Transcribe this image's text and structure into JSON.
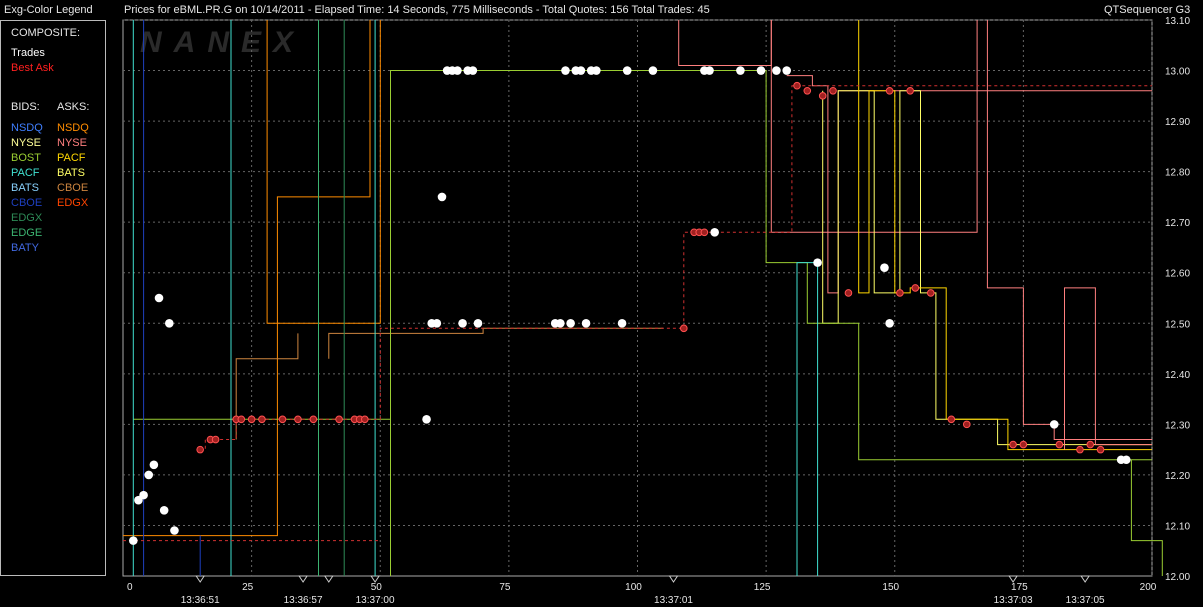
{
  "titlebar": {
    "legend_title": "Exg-Color Legend",
    "chart_title": "Prices for  eBML.PR.G  on  10/14/2011  -  Elapsed Time: 14 Seconds, 775 Milliseconds  -  Total Quotes: 156  Total Trades: 45",
    "app_name": "QTSequencer G3"
  },
  "legend": {
    "composite_label": "COMPOSITE:",
    "trades_label": "Trades",
    "best_ask_label": "Best Ask",
    "bids_header": "BIDS:",
    "asks_header": "ASKS:",
    "bids": [
      {
        "label": "NSDQ",
        "color": "#3f7fff"
      },
      {
        "label": "NYSE",
        "color": "#ffff99"
      },
      {
        "label": "BOST",
        "color": "#9acd32"
      },
      {
        "label": "PACF",
        "color": "#40e0d0"
      },
      {
        "label": "BATS",
        "color": "#87cefa"
      },
      {
        "label": "CBOE",
        "color": "#1e40c0"
      },
      {
        "label": "EDGX",
        "color": "#2e8b57"
      },
      {
        "label": "EDGE",
        "color": "#3cb371"
      },
      {
        "label": "BATY",
        "color": "#4169e1"
      }
    ],
    "asks": [
      {
        "label": "NSDQ",
        "color": "#ff8c00"
      },
      {
        "label": "NYSE",
        "color": "#ff7f7f"
      },
      {
        "label": "PACF",
        "color": "#ffd700"
      },
      {
        "label": "BATS",
        "color": "#ffff66"
      },
      {
        "label": "CBOE",
        "color": "#cd853f"
      },
      {
        "label": "EDGX",
        "color": "#ff4500"
      }
    ],
    "trades_color": "#ffffff",
    "best_ask_color": "#ff2020"
  },
  "watermark": "NANEX",
  "chart_data": {
    "type": "scatter",
    "x_ticks": [
      0,
      25,
      50,
      75,
      100,
      125,
      150,
      175,
      200
    ],
    "x_range": [
      0,
      200
    ],
    "y_ticks": [
      "12.00",
      "12.10",
      "12.20",
      "12.30",
      "12.40",
      "12.50",
      "12.60",
      "12.70",
      "12.80",
      "12.90",
      "13.00",
      "13.10"
    ],
    "y_range": [
      12.0,
      13.1
    ],
    "time_labels": [
      {
        "x": 15,
        "label": "13:36:51"
      },
      {
        "x": 35,
        "label": "13:36:57"
      },
      {
        "x": 49,
        "label": "13:37:00"
      },
      {
        "x": 107,
        "label": "13:37:01"
      },
      {
        "x": 173,
        "label": "13:37:03"
      },
      {
        "x": 187,
        "label": "13:37:05"
      }
    ],
    "time_markers": [
      15,
      35,
      40,
      49,
      107,
      173,
      187
    ],
    "grid": true,
    "trades": [
      {
        "x": 2,
        "y": 12.07
      },
      {
        "x": 3,
        "y": 12.15
      },
      {
        "x": 4,
        "y": 12.16
      },
      {
        "x": 5,
        "y": 12.2
      },
      {
        "x": 6,
        "y": 12.22
      },
      {
        "x": 7,
        "y": 12.55
      },
      {
        "x": 8,
        "y": 12.13
      },
      {
        "x": 9,
        "y": 12.5
      },
      {
        "x": 10,
        "y": 12.09
      },
      {
        "x": 59,
        "y": 12.31
      },
      {
        "x": 60,
        "y": 12.5
      },
      {
        "x": 61,
        "y": 12.5
      },
      {
        "x": 62,
        "y": 12.75
      },
      {
        "x": 63,
        "y": 13.0
      },
      {
        "x": 64,
        "y": 13.0
      },
      {
        "x": 65,
        "y": 13.0
      },
      {
        "x": 66,
        "y": 12.5
      },
      {
        "x": 67,
        "y": 13.0
      },
      {
        "x": 68,
        "y": 13.0
      },
      {
        "x": 69,
        "y": 12.5
      },
      {
        "x": 84,
        "y": 12.5
      },
      {
        "x": 85,
        "y": 12.5
      },
      {
        "x": 86,
        "y": 13.0
      },
      {
        "x": 87,
        "y": 12.5
      },
      {
        "x": 88,
        "y": 13.0
      },
      {
        "x": 89,
        "y": 13.0
      },
      {
        "x": 90,
        "y": 12.5
      },
      {
        "x": 91,
        "y": 13.0
      },
      {
        "x": 92,
        "y": 13.0
      },
      {
        "x": 97,
        "y": 12.5
      },
      {
        "x": 98,
        "y": 13.0
      },
      {
        "x": 103,
        "y": 13.0
      },
      {
        "x": 113,
        "y": 13.0
      },
      {
        "x": 114,
        "y": 13.0
      },
      {
        "x": 115,
        "y": 12.68
      },
      {
        "x": 120,
        "y": 13.0
      },
      {
        "x": 124,
        "y": 13.0
      },
      {
        "x": 127,
        "y": 13.0
      },
      {
        "x": 129,
        "y": 13.0
      },
      {
        "x": 135,
        "y": 12.62
      },
      {
        "x": 148,
        "y": 12.61
      },
      {
        "x": 149,
        "y": 12.5
      },
      {
        "x": 181,
        "y": 12.3
      },
      {
        "x": 194,
        "y": 12.23
      },
      {
        "x": 195,
        "y": 12.23
      }
    ],
    "best_ask_dots": [
      {
        "x": 15,
        "y": 12.25
      },
      {
        "x": 17,
        "y": 12.27
      },
      {
        "x": 18,
        "y": 12.27
      },
      {
        "x": 22,
        "y": 12.31
      },
      {
        "x": 23,
        "y": 12.31
      },
      {
        "x": 25,
        "y": 12.31
      },
      {
        "x": 27,
        "y": 12.31
      },
      {
        "x": 31,
        "y": 12.31
      },
      {
        "x": 34,
        "y": 12.31
      },
      {
        "x": 37,
        "y": 12.31
      },
      {
        "x": 42,
        "y": 12.31
      },
      {
        "x": 45,
        "y": 12.31
      },
      {
        "x": 46,
        "y": 12.31
      },
      {
        "x": 47,
        "y": 12.31
      },
      {
        "x": 109,
        "y": 12.49
      },
      {
        "x": 111,
        "y": 12.68
      },
      {
        "x": 112,
        "y": 12.68
      },
      {
        "x": 113,
        "y": 12.68
      },
      {
        "x": 131,
        "y": 12.97
      },
      {
        "x": 133,
        "y": 12.96
      },
      {
        "x": 136,
        "y": 12.95
      },
      {
        "x": 138,
        "y": 12.96
      },
      {
        "x": 141,
        "y": 12.56
      },
      {
        "x": 149,
        "y": 12.96
      },
      {
        "x": 151,
        "y": 12.56
      },
      {
        "x": 153,
        "y": 12.96
      },
      {
        "x": 154,
        "y": 12.57
      },
      {
        "x": 157,
        "y": 12.56
      },
      {
        "x": 161,
        "y": 12.31
      },
      {
        "x": 164,
        "y": 12.3
      },
      {
        "x": 173,
        "y": 12.26
      },
      {
        "x": 175,
        "y": 12.26
      },
      {
        "x": 182,
        "y": 12.26
      },
      {
        "x": 186,
        "y": 12.25
      },
      {
        "x": 188,
        "y": 12.26
      },
      {
        "x": 190,
        "y": 12.25
      }
    ],
    "best_ask_path": [
      [
        0,
        12.07
      ],
      [
        50,
        12.07
      ]
    ],
    "best_ask_path2": [
      [
        15,
        12.25
      ],
      [
        16,
        12.25
      ],
      [
        16,
        12.27
      ],
      [
        22,
        12.27
      ],
      [
        22,
        12.31
      ],
      [
        50,
        12.31
      ],
      [
        50,
        12.49
      ],
      [
        109,
        12.49
      ],
      [
        109,
        12.68
      ],
      [
        130,
        12.68
      ],
      [
        130,
        12.97
      ],
      [
        200,
        12.97
      ]
    ],
    "quote_lines": [
      {
        "color": "#ff8c00",
        "pts": [
          [
            0,
            12.08
          ],
          [
            30,
            12.08
          ],
          [
            30,
            12.75
          ],
          [
            48,
            12.75
          ],
          [
            48,
            13.1
          ]
        ]
      },
      {
        "color": "#ff8c00",
        "pts": [
          [
            28,
            13.1
          ],
          [
            28,
            12.5
          ],
          [
            50,
            12.5
          ],
          [
            50,
            13.1
          ]
        ]
      },
      {
        "color": "#ff7f7f",
        "pts": [
          [
            108,
            13.1
          ],
          [
            108,
            13.01
          ],
          [
            126,
            13.01
          ],
          [
            126,
            13.1
          ]
        ]
      },
      {
        "color": "#ff7f7f",
        "pts": [
          [
            126,
            13.1
          ],
          [
            126,
            12.68
          ],
          [
            166,
            12.68
          ],
          [
            166,
            13.1
          ]
        ]
      },
      {
        "color": "#cd853f",
        "pts": [
          [
            40,
            12.43
          ],
          [
            40,
            12.48
          ],
          [
            70,
            12.48
          ],
          [
            70,
            12.49
          ],
          [
            105,
            12.49
          ]
        ]
      },
      {
        "color": "#cd853f",
        "pts": [
          [
            22,
            12.27
          ],
          [
            22,
            12.43
          ],
          [
            34,
            12.43
          ],
          [
            34,
            12.48
          ]
        ]
      },
      {
        "color": "#ff7f7f",
        "pts": [
          [
            129,
            12.99
          ],
          [
            134,
            12.99
          ],
          [
            134,
            12.97
          ],
          [
            137,
            12.97
          ],
          [
            137,
            12.56
          ],
          [
            139,
            12.56
          ],
          [
            139,
            12.96
          ],
          [
            200,
            12.96
          ]
        ]
      },
      {
        "color": "#ffff66",
        "pts": [
          [
            136,
            12.96
          ],
          [
            136,
            12.5
          ],
          [
            139,
            12.5
          ],
          [
            139,
            12.96
          ],
          [
            146,
            12.96
          ],
          [
            146,
            12.56
          ],
          [
            151,
            12.56
          ],
          [
            151,
            12.96
          ],
          [
            155,
            12.96
          ],
          [
            155,
            12.56
          ],
          [
            158,
            12.56
          ],
          [
            158,
            12.31
          ],
          [
            170,
            12.31
          ],
          [
            170,
            12.26
          ],
          [
            200,
            12.26
          ]
        ]
      },
      {
        "color": "#ffd700",
        "pts": [
          [
            143,
            13.1
          ],
          [
            143,
            12.56
          ],
          [
            145,
            12.56
          ],
          [
            145,
            12.96
          ],
          [
            150,
            12.96
          ],
          [
            150,
            12.56
          ],
          [
            153,
            12.56
          ],
          [
            153,
            12.57
          ],
          [
            160,
            12.57
          ],
          [
            160,
            12.31
          ],
          [
            172,
            12.31
          ],
          [
            172,
            12.25
          ],
          [
            200,
            12.25
          ]
        ]
      },
      {
        "color": "#ff7f7f",
        "pts": [
          [
            168,
            13.1
          ],
          [
            168,
            12.57
          ],
          [
            175,
            12.57
          ],
          [
            175,
            12.3
          ],
          [
            181,
            12.3
          ],
          [
            181,
            12.27
          ],
          [
            200,
            12.27
          ]
        ]
      },
      {
        "color": "#ff7f7f",
        "pts": [
          [
            183,
            12.25
          ],
          [
            183,
            12.57
          ],
          [
            189,
            12.57
          ],
          [
            189,
            12.26
          ],
          [
            200,
            12.26
          ]
        ]
      },
      {
        "color": "#9acd32",
        "pts": [
          [
            2,
            12.31
          ],
          [
            52,
            12.31
          ],
          [
            52,
            12.0
          ]
        ]
      },
      {
        "color": "#9acd32",
        "pts": [
          [
            52,
            12.0
          ],
          [
            52,
            13.0
          ],
          [
            125,
            13.0
          ],
          [
            125,
            12.62
          ],
          [
            133,
            12.62
          ],
          [
            133,
            12.5
          ],
          [
            143,
            12.5
          ],
          [
            143,
            12.23
          ],
          [
            200,
            12.23
          ]
        ]
      },
      {
        "color": "#9acd32",
        "pts": [
          [
            196,
            12.23
          ],
          [
            196,
            12.07
          ],
          [
            202,
            12.07
          ],
          [
            202,
            12.0
          ]
        ]
      },
      {
        "color": "#40e0d0",
        "pts": [
          [
            2,
            13.1
          ],
          [
            2,
            12.0
          ]
        ]
      },
      {
        "color": "#40e0d0",
        "pts": [
          [
            21,
            13.1
          ],
          [
            21,
            12.0
          ]
        ]
      },
      {
        "color": "#40e0d0",
        "pts": [
          [
            49,
            13.1
          ],
          [
            49,
            12.0
          ]
        ]
      },
      {
        "color": "#40e0d0",
        "pts": [
          [
            131,
            12.0
          ],
          [
            131,
            12.62
          ],
          [
            135,
            12.62
          ],
          [
            135,
            12.0
          ]
        ]
      },
      {
        "color": "#1e40c0",
        "pts": [
          [
            4,
            13.1
          ],
          [
            4,
            12.0
          ]
        ]
      },
      {
        "color": "#1e40c0",
        "pts": [
          [
            15,
            12.08
          ],
          [
            15,
            12.0
          ]
        ]
      },
      {
        "color": "#3cb371",
        "pts": [
          [
            38,
            13.1
          ],
          [
            38,
            12.0
          ]
        ]
      },
      {
        "color": "#2e8b57",
        "pts": [
          [
            43,
            13.1
          ],
          [
            43,
            12.0
          ]
        ]
      }
    ]
  }
}
